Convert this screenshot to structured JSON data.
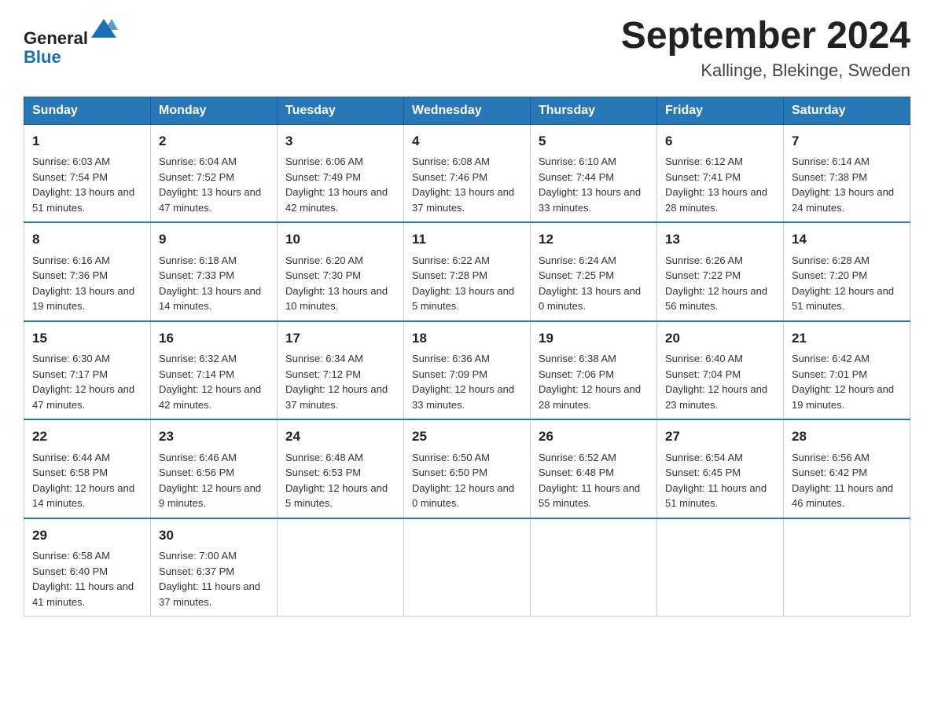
{
  "header": {
    "logo_general": "General",
    "logo_blue": "Blue",
    "month_year": "September 2024",
    "location": "Kallinge, Blekinge, Sweden"
  },
  "days_of_week": [
    "Sunday",
    "Monday",
    "Tuesday",
    "Wednesday",
    "Thursday",
    "Friday",
    "Saturday"
  ],
  "weeks": [
    [
      {
        "day": "1",
        "sunrise": "6:03 AM",
        "sunset": "7:54 PM",
        "daylight": "13 hours and 51 minutes."
      },
      {
        "day": "2",
        "sunrise": "6:04 AM",
        "sunset": "7:52 PM",
        "daylight": "13 hours and 47 minutes."
      },
      {
        "day": "3",
        "sunrise": "6:06 AM",
        "sunset": "7:49 PM",
        "daylight": "13 hours and 42 minutes."
      },
      {
        "day": "4",
        "sunrise": "6:08 AM",
        "sunset": "7:46 PM",
        "daylight": "13 hours and 37 minutes."
      },
      {
        "day": "5",
        "sunrise": "6:10 AM",
        "sunset": "7:44 PM",
        "daylight": "13 hours and 33 minutes."
      },
      {
        "day": "6",
        "sunrise": "6:12 AM",
        "sunset": "7:41 PM",
        "daylight": "13 hours and 28 minutes."
      },
      {
        "day": "7",
        "sunrise": "6:14 AM",
        "sunset": "7:38 PM",
        "daylight": "13 hours and 24 minutes."
      }
    ],
    [
      {
        "day": "8",
        "sunrise": "6:16 AM",
        "sunset": "7:36 PM",
        "daylight": "13 hours and 19 minutes."
      },
      {
        "day": "9",
        "sunrise": "6:18 AM",
        "sunset": "7:33 PM",
        "daylight": "13 hours and 14 minutes."
      },
      {
        "day": "10",
        "sunrise": "6:20 AM",
        "sunset": "7:30 PM",
        "daylight": "13 hours and 10 minutes."
      },
      {
        "day": "11",
        "sunrise": "6:22 AM",
        "sunset": "7:28 PM",
        "daylight": "13 hours and 5 minutes."
      },
      {
        "day": "12",
        "sunrise": "6:24 AM",
        "sunset": "7:25 PM",
        "daylight": "13 hours and 0 minutes."
      },
      {
        "day": "13",
        "sunrise": "6:26 AM",
        "sunset": "7:22 PM",
        "daylight": "12 hours and 56 minutes."
      },
      {
        "day": "14",
        "sunrise": "6:28 AM",
        "sunset": "7:20 PM",
        "daylight": "12 hours and 51 minutes."
      }
    ],
    [
      {
        "day": "15",
        "sunrise": "6:30 AM",
        "sunset": "7:17 PM",
        "daylight": "12 hours and 47 minutes."
      },
      {
        "day": "16",
        "sunrise": "6:32 AM",
        "sunset": "7:14 PM",
        "daylight": "12 hours and 42 minutes."
      },
      {
        "day": "17",
        "sunrise": "6:34 AM",
        "sunset": "7:12 PM",
        "daylight": "12 hours and 37 minutes."
      },
      {
        "day": "18",
        "sunrise": "6:36 AM",
        "sunset": "7:09 PM",
        "daylight": "12 hours and 33 minutes."
      },
      {
        "day": "19",
        "sunrise": "6:38 AM",
        "sunset": "7:06 PM",
        "daylight": "12 hours and 28 minutes."
      },
      {
        "day": "20",
        "sunrise": "6:40 AM",
        "sunset": "7:04 PM",
        "daylight": "12 hours and 23 minutes."
      },
      {
        "day": "21",
        "sunrise": "6:42 AM",
        "sunset": "7:01 PM",
        "daylight": "12 hours and 19 minutes."
      }
    ],
    [
      {
        "day": "22",
        "sunrise": "6:44 AM",
        "sunset": "6:58 PM",
        "daylight": "12 hours and 14 minutes."
      },
      {
        "day": "23",
        "sunrise": "6:46 AM",
        "sunset": "6:56 PM",
        "daylight": "12 hours and 9 minutes."
      },
      {
        "day": "24",
        "sunrise": "6:48 AM",
        "sunset": "6:53 PM",
        "daylight": "12 hours and 5 minutes."
      },
      {
        "day": "25",
        "sunrise": "6:50 AM",
        "sunset": "6:50 PM",
        "daylight": "12 hours and 0 minutes."
      },
      {
        "day": "26",
        "sunrise": "6:52 AM",
        "sunset": "6:48 PM",
        "daylight": "11 hours and 55 minutes."
      },
      {
        "day": "27",
        "sunrise": "6:54 AM",
        "sunset": "6:45 PM",
        "daylight": "11 hours and 51 minutes."
      },
      {
        "day": "28",
        "sunrise": "6:56 AM",
        "sunset": "6:42 PM",
        "daylight": "11 hours and 46 minutes."
      }
    ],
    [
      {
        "day": "29",
        "sunrise": "6:58 AM",
        "sunset": "6:40 PM",
        "daylight": "11 hours and 41 minutes."
      },
      {
        "day": "30",
        "sunrise": "7:00 AM",
        "sunset": "6:37 PM",
        "daylight": "11 hours and 37 minutes."
      },
      null,
      null,
      null,
      null,
      null
    ]
  ],
  "labels": {
    "sunrise_prefix": "Sunrise: ",
    "sunset_prefix": "Sunset: ",
    "daylight_prefix": "Daylight: "
  }
}
